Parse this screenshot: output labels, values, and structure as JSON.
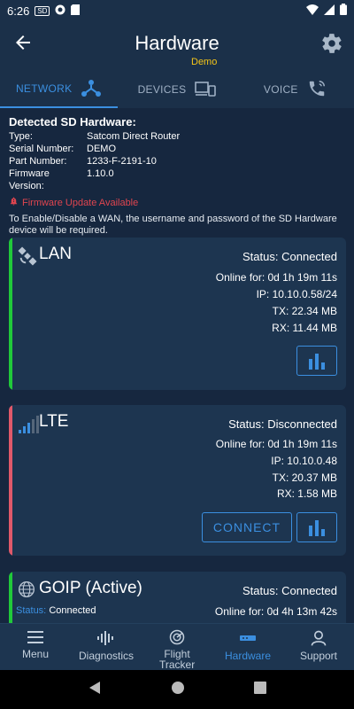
{
  "status_bar": {
    "time": "6:26",
    "sd_label": "SD"
  },
  "app_bar": {
    "title": "Hardware",
    "subtitle": "Demo"
  },
  "tabs": [
    {
      "label": "NETWORK",
      "icon": "network-icon",
      "active": true
    },
    {
      "label": "DEVICES",
      "icon": "devices-icon",
      "active": false
    },
    {
      "label": "VOICE",
      "icon": "phone-icon",
      "active": false
    }
  ],
  "hardware": {
    "heading": "Detected SD Hardware:",
    "rows": [
      {
        "label": "Type:",
        "value": "Satcom Direct Router"
      },
      {
        "label": "Serial Number:",
        "value": "DEMO"
      },
      {
        "label": "Part Number:",
        "value": "1233-F-2191-10"
      },
      {
        "label": "Firmware Version:",
        "value": "1.10.0"
      }
    ],
    "firmware_alert": "Firmware Update Available",
    "note": "To Enable/Disable a WAN, the username and password of the SD Hardware device will be required."
  },
  "cards": {
    "lan": {
      "name": "LAN",
      "status_label": "Status:",
      "status_value": "Connected",
      "online_label": "Online for:",
      "online_value": "0d 1h 19m 11s",
      "ip_label": "IP:",
      "ip_value": "10.10.0.58/24",
      "tx_label": "TX:",
      "tx_value": "22.34 MB",
      "rx_label": "RX:",
      "rx_value": "11.44 MB",
      "stripe_color": "#21c93a"
    },
    "lte": {
      "name": "LTE",
      "status_label": "Status:",
      "status_value": "Disconnected",
      "online_label": "Online for:",
      "online_value": "0d 1h 19m 11s",
      "ip_label": "IP:",
      "ip_value": "10.10.0.48",
      "tx_label": "TX:",
      "tx_value": "20.37 MB",
      "rx_label": "RX:",
      "rx_value": "1.58 MB",
      "connect_label": "CONNECT",
      "stripe_color": "#e0596a"
    },
    "goip": {
      "name": "GOIP (Active)",
      "status_label": "Status:",
      "status_value": "Connected",
      "sub_status": "Status: Connected",
      "sub_status_label": "Status:",
      "sub_status_value": "Connected",
      "online_label": "Online for:",
      "online_value": "0d 4h 13m 42s",
      "stripe_color": "#21c93a"
    }
  },
  "bottom_nav": [
    {
      "label": "Menu",
      "icon": "menu-icon",
      "active": false
    },
    {
      "label": "Diagnostics",
      "icon": "waveform-icon",
      "active": false
    },
    {
      "label": "Flight Tracker",
      "icon": "radar-icon",
      "active": false
    },
    {
      "label": "Hardware",
      "icon": "router-icon",
      "active": true
    },
    {
      "label": "Support",
      "icon": "support-agent-icon",
      "active": false
    }
  ],
  "colors": {
    "accent": "#3b8fe0",
    "demo": "#f5c518",
    "alert": "#e0454f",
    "connected": "#21c93a",
    "disconnected": "#e0596a"
  }
}
